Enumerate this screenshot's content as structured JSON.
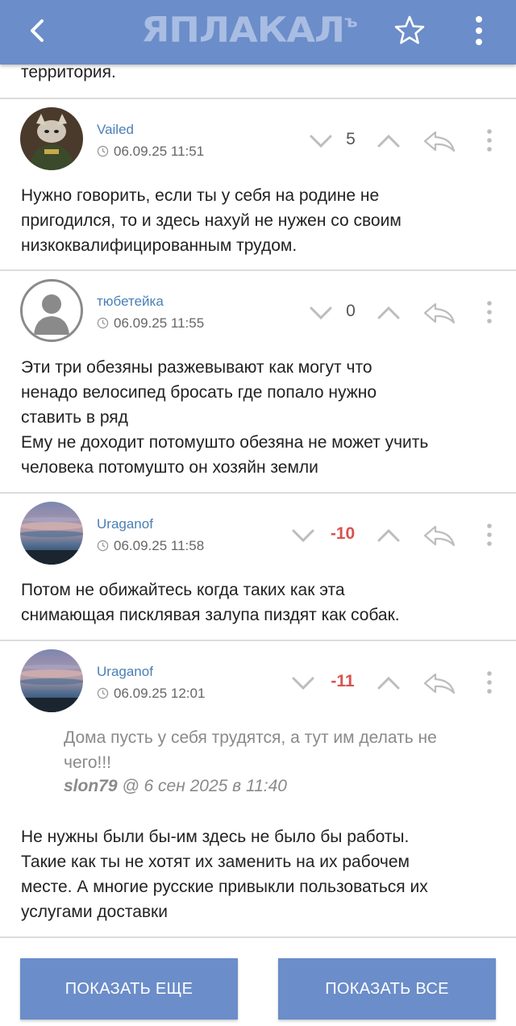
{
  "header": {
    "logo_main": "ЯПЛАКАЛ",
    "logo_sup": "ъ"
  },
  "top_text": "территория.",
  "comments": [
    {
      "username": "Vailed",
      "date": "06.09.25 11:51",
      "rating": "5",
      "text_lines": [
        "Нужно говорить, если ты у себя на родине не",
        "пригодился, то и здесь нахуй не нужен со своим",
        "низкоквалифицированным трудом."
      ]
    },
    {
      "username": "тюбетейка",
      "date": "06.09.25 11:55",
      "rating": "0",
      "text_lines": [
        "Эти три обезяны разжевывают как могут что",
        "ненадо велосипед бросать где попало нужно",
        "ставить в ряд",
        "Ему не доходит потомушто обезяна не может учить",
        "человека потомушто он хозяйн земли"
      ]
    },
    {
      "username": "Uraganof",
      "date": "06.09.25 11:58",
      "rating": "-10",
      "text_lines": [
        "Потом не обижайтесь когда таких как эта",
        "снимающая писклявая залупа пиздят как собак."
      ]
    },
    {
      "username": "Uraganof",
      "date": "06.09.25 12:01",
      "rating": "-11",
      "quote": {
        "lines": [
          "Дома пусть у себя трудятся, а тут им делать не",
          "чего!!!"
        ],
        "author": "slon79",
        "meta": " @ 6 сен 2025 в 11:40"
      },
      "text_lines": [
        "Не нужны были бы-им здесь не было бы работы.",
        "Такие как ты не хотят их заменить на их рабочем",
        "месте. А многие русские привыкли пользоваться их",
        "услугами доставки"
      ]
    }
  ],
  "buttons": {
    "show_more": "ПОКАЗАТЬ ЕЩЕ",
    "show_all": "ПОКАЗАТЬ ВСЕ"
  },
  "colors": {
    "header": "#6b8dc9",
    "username": "#4a7fb5",
    "negative": "#d9534f"
  },
  "icons": {
    "back": "chevron-left-icon",
    "favorite": "star-icon",
    "menu": "more-vertical-icon",
    "vote_down": "chevron-down-icon",
    "vote_up": "chevron-up-icon",
    "reply": "reply-arrow-icon",
    "clock": "clock-icon"
  }
}
